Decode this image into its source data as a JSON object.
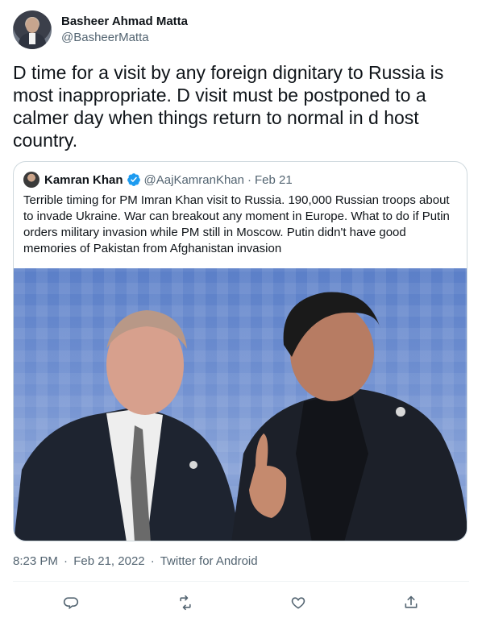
{
  "author": {
    "display_name": "Basheer Ahmad Matta",
    "handle": "@BasheerMatta"
  },
  "tweet": {
    "text": "D time for a visit by any foreign dignitary to Russia is most inappropriate. D visit must be postponed to a calmer day when things return to normal in d host country."
  },
  "quoted": {
    "display_name": "Kamran Khan",
    "verified_icon": "verified-badge-icon",
    "handle": "@AajKamranKhan",
    "separator": "·",
    "date": "Feb 21",
    "text": "Terrible timing for PM Imran Khan visit to Russia. 190,000 Russian troops about to invade Ukraine. War can breakout any moment in Europe. What to do if Putin orders military invasion while PM still in Moscow. Putin didn't have good memories of Pakistan from Afghanistan invasion"
  },
  "timestamp": {
    "time": "8:23 PM",
    "sep1": "·",
    "date": "Feb 21, 2022",
    "sep2": "·",
    "source": "Twitter for Android"
  },
  "actions": [
    {
      "name": "reply",
      "icon": "reply-icon"
    },
    {
      "name": "retweet",
      "icon": "retweet-icon"
    },
    {
      "name": "like",
      "icon": "like-icon"
    },
    {
      "name": "share",
      "icon": "share-icon"
    }
  ],
  "colors": {
    "text": "#0f1419",
    "secondary": "#536471",
    "border": "#cfd9de",
    "verified": "#1d9bf0"
  }
}
